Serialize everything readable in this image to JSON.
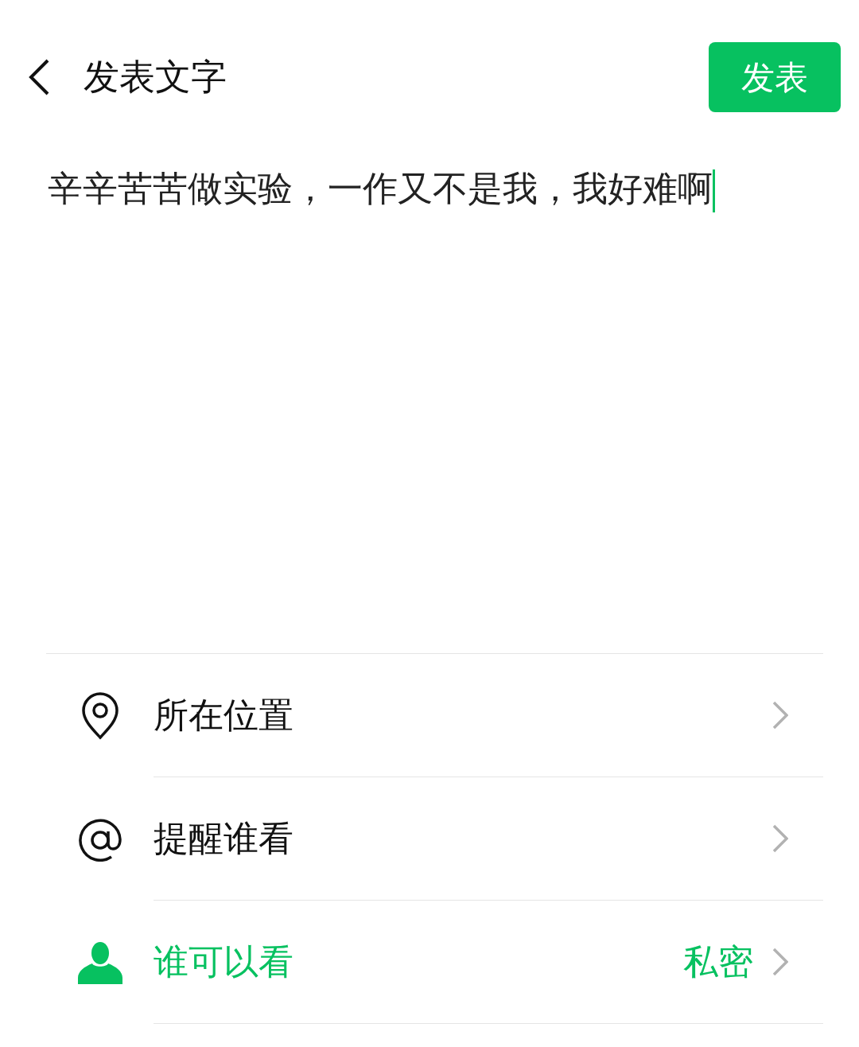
{
  "header": {
    "title": "发表文字",
    "publish_button": "发表"
  },
  "post": {
    "value": "辛辛苦苦做实验，一作又不是我，我好难啊",
    "focused": true
  },
  "options": [
    {
      "kind": "location",
      "label": "所在位置",
      "highlighted": false
    },
    {
      "kind": "mention",
      "label": "提醒谁看",
      "highlighted": false
    },
    {
      "kind": "person",
      "label": "谁可以看",
      "value": "私密",
      "highlighted": true
    }
  ]
}
